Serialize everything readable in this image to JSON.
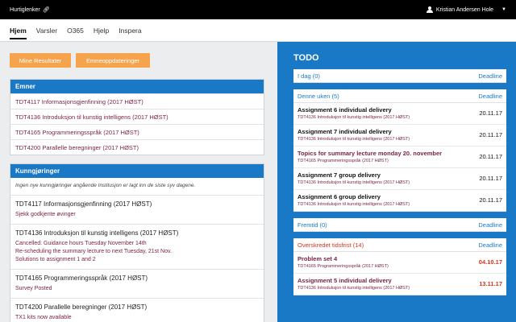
{
  "topbar": {
    "quick_links": "Hurtiglenker",
    "user_name": "Kristian Andersen Hole"
  },
  "nav": {
    "tabs": [
      "Hjem",
      "Varsler",
      "O365",
      "Hjelp",
      "Inspera"
    ]
  },
  "buttons": {
    "results": "Mine Resultater",
    "updates": "Emneoppdateringer"
  },
  "emner": {
    "title": "Emner",
    "courses": [
      "TDT4117 Informasjonsgjenfinning (2017 HØST)",
      "TDT4136 Introduksjon til kunstig intelligens (2017 HØST)",
      "TDT4165 Programmeringsspråk (2017 HØST)",
      "TDT4200 Parallelle beregninger (2017 HØST)"
    ]
  },
  "kunngjoringer": {
    "title": "Kunngjøringer",
    "note": "Ingen nye kunngjøringer angående Institusjon er lagt inn de siste syv dagene.",
    "items": [
      {
        "course": "TDT4117 Informasjonsgjenfinning (2017 HØST)",
        "lines": [
          "Sjekk godkjente øvinger"
        ]
      },
      {
        "course": "TDT4136 Introduksjon til kunstig intelligens (2017 HØST)",
        "lines": [
          "Cancelled: Guidance hours Tuesday November 14th",
          "Re-scheduling the summary lecture to next Tuesday, 21st Nov.",
          "Solutions to assignment 1 and 2"
        ]
      },
      {
        "course": "TDT4165 Programmeringsspråk (2017 HØST)",
        "lines": [
          "Survey Posted"
        ]
      },
      {
        "course": "TDT4200 Parallelle beregninger (2017 HØST)",
        "lines": [
          "TX1 kits now available"
        ]
      }
    ]
  },
  "todo": {
    "title": "TODO",
    "deadline_label": "Deadline",
    "today": "I dag (0)",
    "week": "Denne uken (5)",
    "future": "Fremtid (0)",
    "overdue": "Overskredet tidsfrist (14)",
    "week_items": [
      {
        "name": "Assignment 6 individual delivery",
        "course": "TDT4136 Introduksjon til kunstig intelligens (2017 HØST)",
        "date": "20.11.17"
      },
      {
        "name": "Assignment 7 individual delivery",
        "course": "TDT4136 Introduksjon til kunstig intelligens (2017 HØST)",
        "date": "20.11.17"
      },
      {
        "name": "Topics for summary lecture monday 20. november",
        "course": "TDT4165 Programmeringsspråk (2017 HØST)",
        "date": "20.11.17"
      },
      {
        "name": "Assignment 7 group delivery",
        "course": "TDT4136 Introduksjon til kunstig intelligens (2017 HØST)",
        "date": "20.11.17"
      },
      {
        "name": "Assignment 6 group delivery",
        "course": "TDT4136 Introduksjon til kunstig intelligens (2017 HØST)",
        "date": "20.11.17"
      }
    ],
    "overdue_items": [
      {
        "name": "Problem set 4",
        "course": "TDT4165 Programmeringsspråk (2017 HØST)",
        "date": "04.10.17"
      },
      {
        "name": "Assignment 5 individual delivery",
        "course": "TDT4136 Introduksjon til kunstig intelligens (2017 HØST)",
        "date": "13.11.17"
      }
    ]
  },
  "colors": {
    "blue": "#1a79c6",
    "orange": "#f5a34c",
    "course_text": "#7b2346",
    "overdue_red": "#d9331c"
  }
}
